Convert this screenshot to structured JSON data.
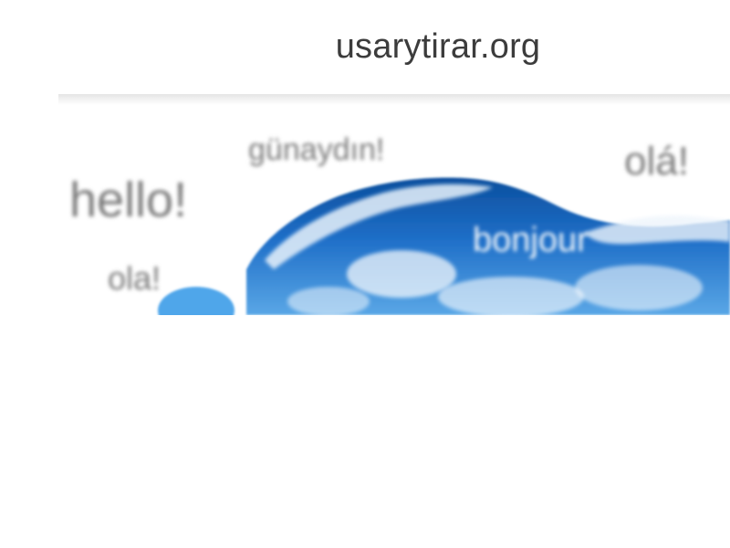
{
  "browser": {
    "url": "usarytirar.org"
  },
  "banner": {
    "greetings": [
      "günaydın!",
      "olá!",
      "hello!",
      "bonjour",
      "ola!"
    ]
  },
  "colors": {
    "url_text": "#3c3c3c",
    "wave_blue": "#1f6fc8",
    "wave_dark": "#0b4f9e",
    "wave_light": "#4fa6ea",
    "greeting_gray": "#7a7a7a"
  }
}
